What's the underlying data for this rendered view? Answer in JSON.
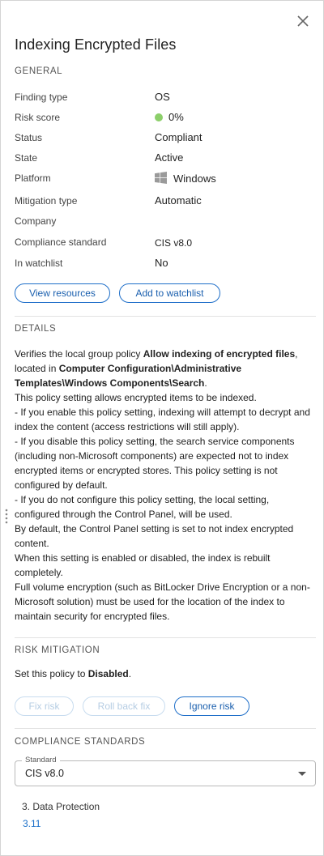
{
  "header": {
    "title": "Indexing Encrypted Files"
  },
  "general": {
    "section_title": "GENERAL",
    "rows": [
      {
        "label": "Finding type",
        "value": "OS"
      },
      {
        "label": "Risk score",
        "value": "0%"
      },
      {
        "label": "Status",
        "value": "Compliant"
      },
      {
        "label": "State",
        "value": "Active"
      },
      {
        "label": "Platform",
        "value": "Windows"
      },
      {
        "label": "Mitigation type",
        "value": "Automatic"
      },
      {
        "label": "Company",
        "value": ""
      },
      {
        "label": "Compliance standard",
        "value": "CIS v8.0"
      },
      {
        "label": "In watchlist",
        "value": "No"
      }
    ],
    "buttons": {
      "view_resources": "View resources",
      "add_to_watchlist": "Add to watchlist"
    }
  },
  "details": {
    "section_title": "DETAILS",
    "p1_prefix": "Verifies the local group policy ",
    "p1_bold1": "Allow indexing of encrypted files",
    "p1_mid": ", located in ",
    "p1_bold2": "Computer Configuration\\Administrative Templates\\Windows Components\\Search",
    "p1_suffix": ".",
    "lines": [
      "This policy setting allows encrypted items to be indexed.",
      "- If you enable this policy setting, indexing will attempt to decrypt and index the content (access restrictions will still apply).",
      "- If you disable this policy setting, the search service components (including non-Microsoft components) are expected not to index encrypted items or encrypted stores. This policy setting is not configured by default.",
      "- If you do not configure this policy setting, the local setting, configured through the Control Panel, will be used.",
      "By default, the Control Panel setting is set to not index encrypted content.",
      "When this setting is enabled or disabled, the index is rebuilt completely.",
      "Full volume encryption (such as BitLocker Drive Encryption or a non-Microsoft solution) must be used for the location of the index to maintain security for encrypted files."
    ]
  },
  "risk_mitigation": {
    "section_title": "RISK MITIGATION",
    "text_prefix": "Set this policy to ",
    "text_bold": "Disabled",
    "text_suffix": ".",
    "buttons": {
      "fix_risk": "Fix risk",
      "roll_back_fix": "Roll back fix",
      "ignore_risk": "Ignore risk"
    }
  },
  "compliance_standards": {
    "section_title": "COMPLIANCE STANDARDS",
    "select": {
      "legend": "Standard",
      "value": "CIS v8.0"
    },
    "heading": "3. Data Protection",
    "link": "3.11"
  },
  "colors": {
    "accent": "#1f6fc9",
    "risk_dot": "#8ccf6a",
    "disabled": "#b6cde3"
  },
  "icons": {
    "close": "close-icon",
    "platform": "windows-icon",
    "drag": "drag-handle-icon",
    "dropdown": "chevron-down-icon"
  }
}
